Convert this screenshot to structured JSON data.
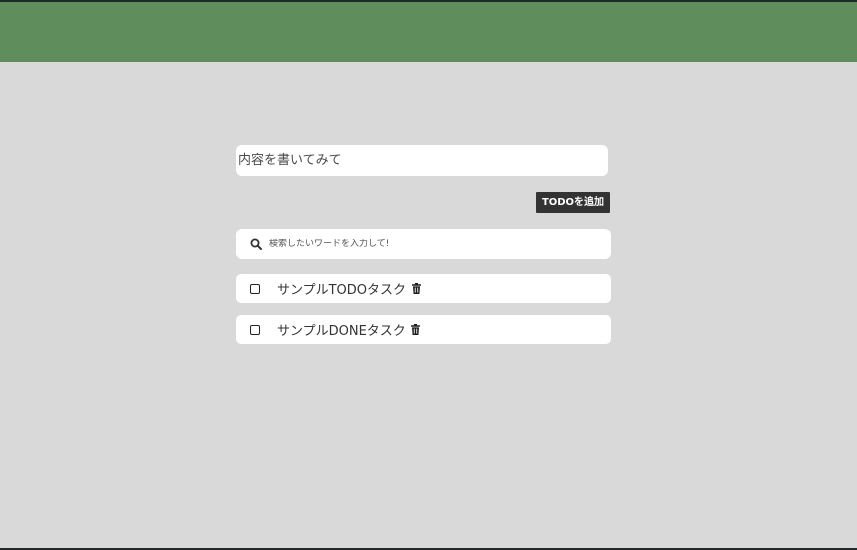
{
  "colors": {
    "header_bg": "#5f8d5b",
    "page_bg": "#d9d9d9",
    "button_bg": "#333333",
    "button_text": "#ffffff"
  },
  "todo_form": {
    "input_placeholder": "内容を書いてみて",
    "input_value": "",
    "add_button_label": "TODOを追加"
  },
  "search": {
    "icon": "search-icon",
    "placeholder": "検索したいワードを入力して!"
  },
  "tasks": [
    {
      "label": "サンプルTODOタスク",
      "checked": false,
      "delete_icon": "trash-icon"
    },
    {
      "label": "サンプルDONEタスク",
      "checked": false,
      "delete_icon": "trash-icon"
    }
  ]
}
